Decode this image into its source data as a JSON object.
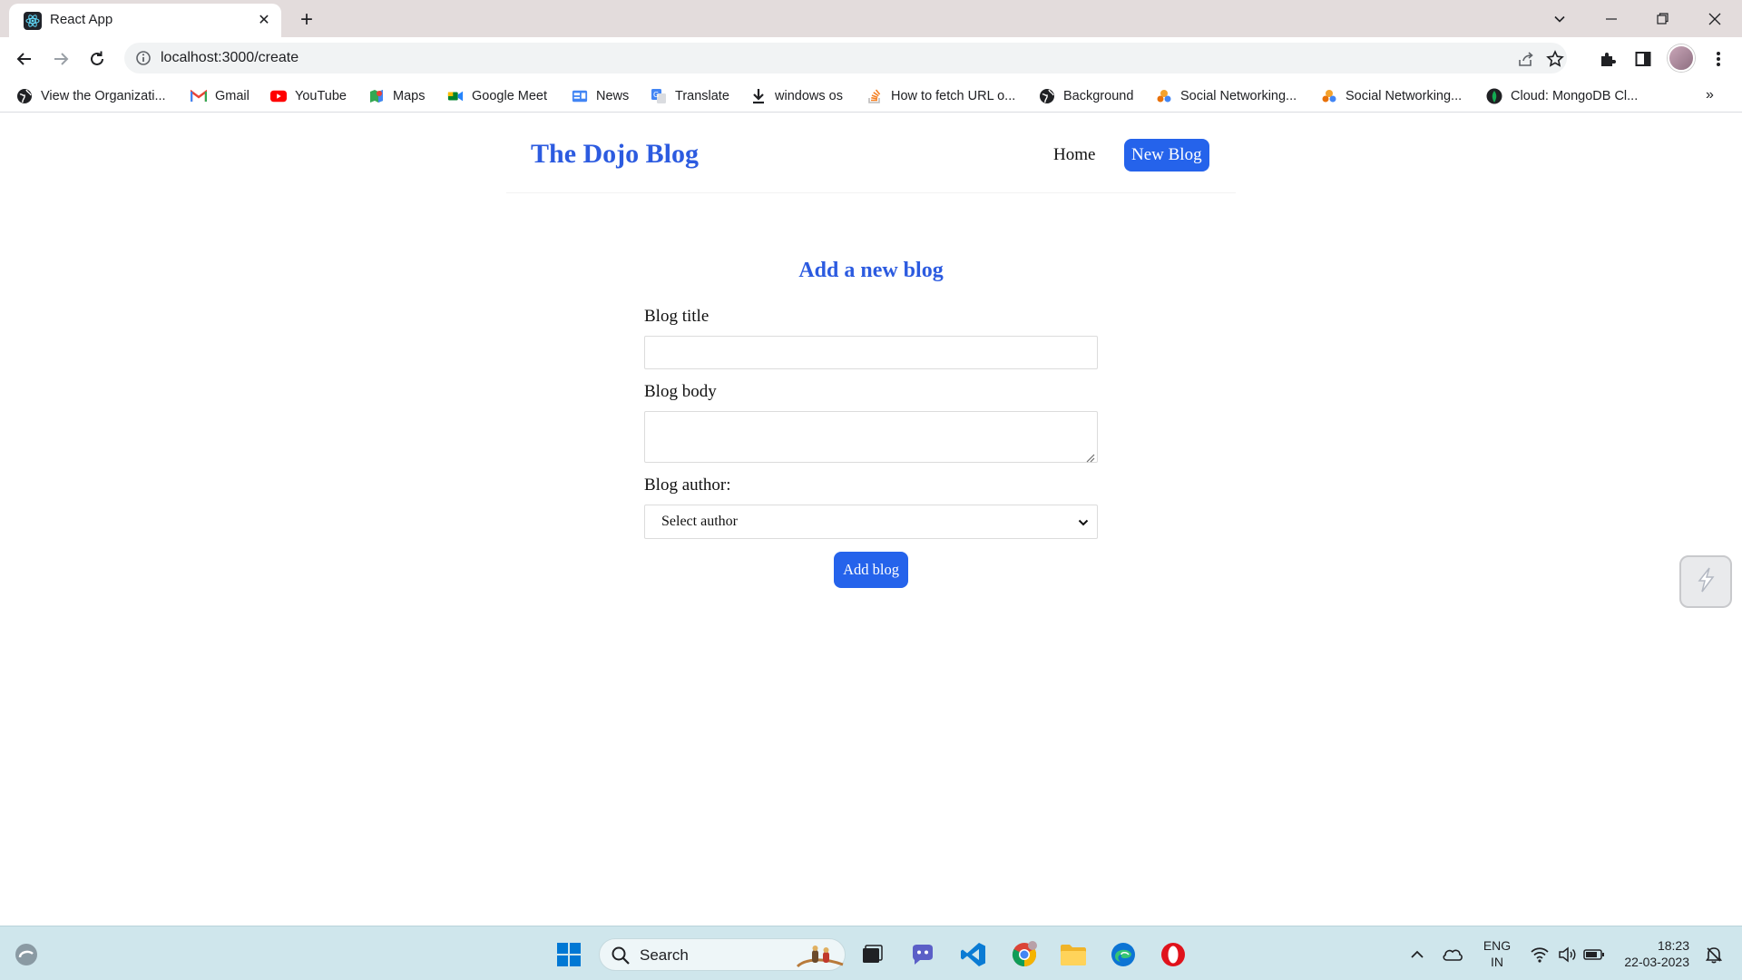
{
  "browser": {
    "tab_title": "React App",
    "url": "localhost:3000/create",
    "bookmarks": [
      {
        "label": "View the Organizati...",
        "icon": "globe-icon"
      },
      {
        "label": "Gmail",
        "icon": "gmail-icon"
      },
      {
        "label": "YouTube",
        "icon": "youtube-icon"
      },
      {
        "label": "Maps",
        "icon": "maps-icon"
      },
      {
        "label": "Google Meet",
        "icon": "meet-icon"
      },
      {
        "label": "News",
        "icon": "news-icon"
      },
      {
        "label": "Translate",
        "icon": "translate-icon"
      },
      {
        "label": "windows os",
        "icon": "download-icon"
      },
      {
        "label": "How to fetch URL o...",
        "icon": "stackoverflow-icon"
      },
      {
        "label": "Background",
        "icon": "globe-icon"
      },
      {
        "label": "Social Networking...",
        "icon": "social-icon"
      },
      {
        "label": "Social Networking...",
        "icon": "social-icon"
      },
      {
        "label": "Cloud: MongoDB Cl...",
        "icon": "mongodb-icon"
      }
    ],
    "bookmarks_more": "»"
  },
  "app": {
    "brand": "The Dojo Blog",
    "nav_home": "Home",
    "nav_new_blog": "New Blog",
    "form_heading": "Add a new blog",
    "title_label": "Blog title",
    "title_value": "",
    "body_label": "Blog body",
    "body_value": "",
    "author_label": "Blog author:",
    "author_selected": "Select author",
    "submit_label": "Add blog"
  },
  "taskbar": {
    "search_label": "Search",
    "language_line1": "ENG",
    "language_line2": "IN",
    "time": "18:23",
    "date": "22-03-2023"
  },
  "colors": {
    "accent": "#2563eb",
    "brand_text": "#2c5be0",
    "tabstrip": "#e3dcdc",
    "taskbar": "#cfe6ec"
  }
}
